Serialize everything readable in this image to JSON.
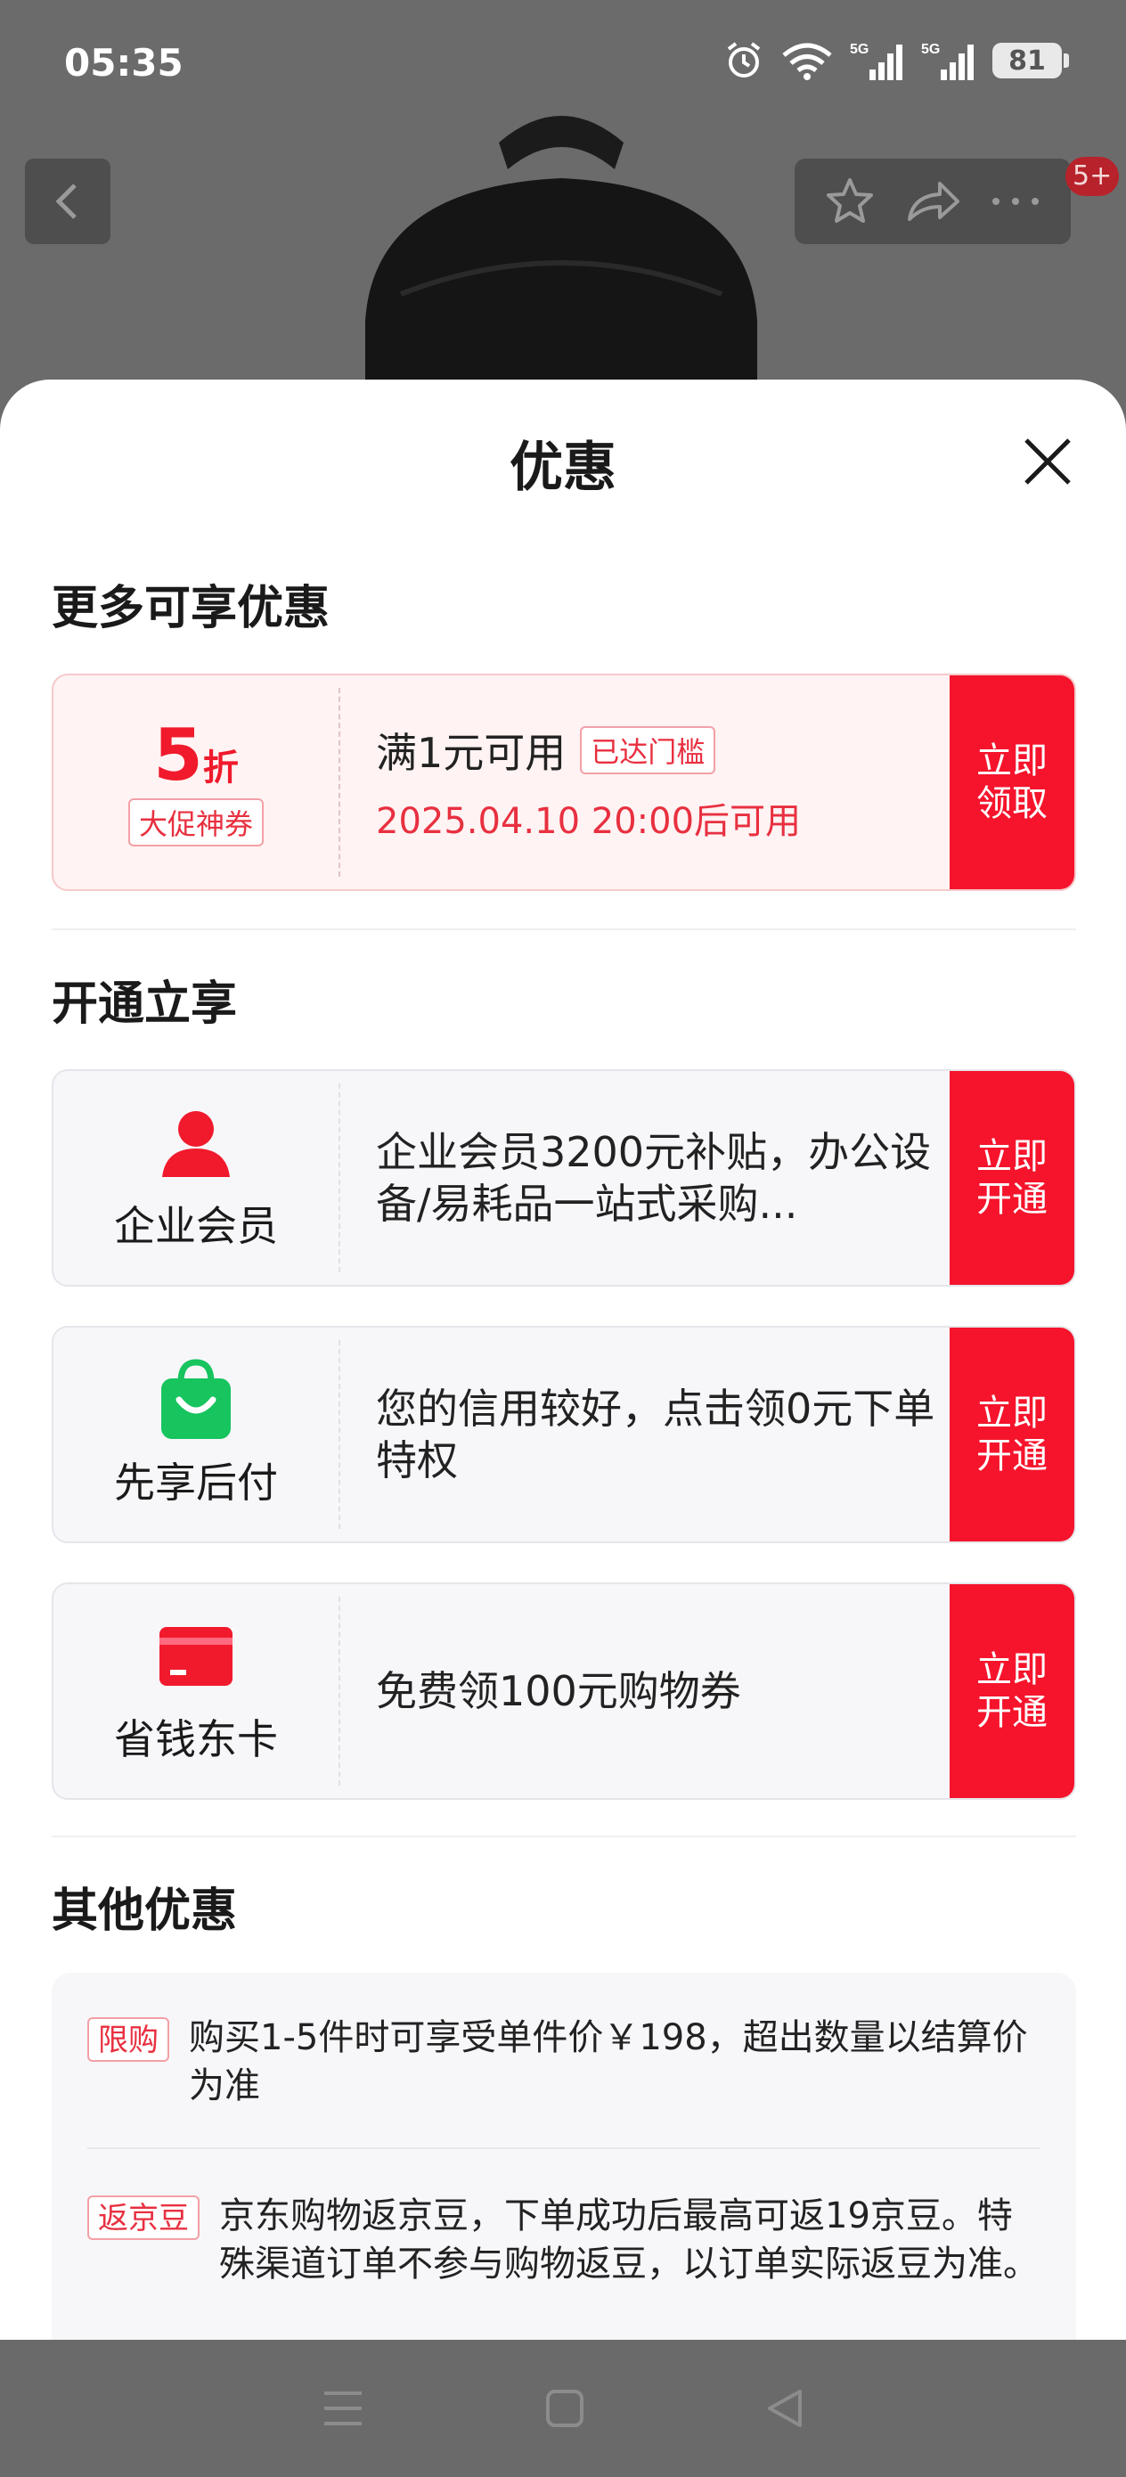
{
  "status_bar": {
    "time": "05:35",
    "battery": "81",
    "network_1": "5G",
    "network_2": "5G"
  },
  "top_nav": {
    "badge": "5+"
  },
  "sheet": {
    "title": "优惠",
    "sections": {
      "more": "更多可享优惠",
      "open": "开通立享",
      "other": "其他优惠"
    }
  },
  "coupon": {
    "discount_num": "5",
    "discount_unit": "折",
    "tag": "大促神券",
    "condition": "满1元可用",
    "reached": "已达门槛",
    "valid_time": "2025.04.10 20:00后可用",
    "button": "立即领取"
  },
  "perks": [
    {
      "icon": "person-icon",
      "label": "企业会员",
      "desc": "企业会员3200元补贴，办公设备/易耗品一站式采购...",
      "button": "立即开通",
      "color": "#f01a2c"
    },
    {
      "icon": "shopping-bag-icon",
      "label": "先享后付",
      "desc": "您的信用较好，点击领0元下单特权",
      "button": "立即开通",
      "color": "#17c45e"
    },
    {
      "icon": "card-icon",
      "label": "省钱东卡",
      "desc": "免费领100元购物券",
      "button": "立即开通",
      "color": "#f01a2c"
    }
  ],
  "other": [
    {
      "tag": "限购",
      "text": "购买1-5件时可享受单件价￥198，超出数量以结算价为准"
    },
    {
      "tag": "返京豆",
      "text": "京东购物返京豆，下单成功后最高可返19京豆。特殊渠道订单不参与购物返豆，以订单实际返豆为准。"
    }
  ],
  "colors": {
    "accent": "#f5142c",
    "perk_bg": "#f7f7fa",
    "coupon_bg": "#fff3f3"
  }
}
